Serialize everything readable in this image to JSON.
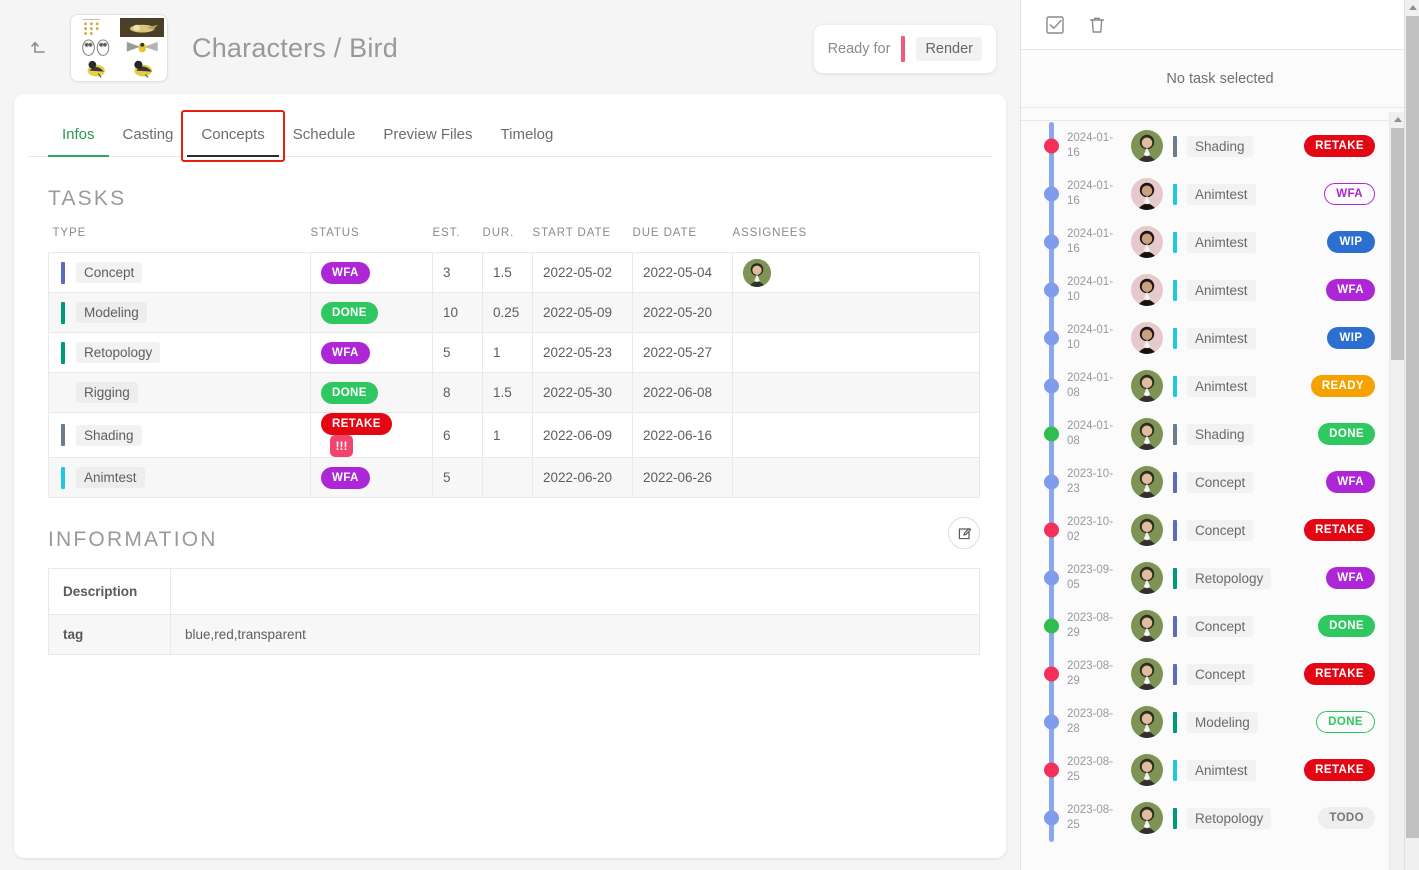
{
  "header": {
    "back_icon": "return-arrow-icon",
    "thumbnail_alt": "bird-concept-thumbnail",
    "title": "Characters / Bird",
    "ready_for_label": "Ready for",
    "ready_for_value": "Render"
  },
  "tabs": [
    {
      "label": "Infos",
      "state": "active-green"
    },
    {
      "label": "Casting",
      "state": ""
    },
    {
      "label": "Concepts",
      "state": "active-dark"
    },
    {
      "label": "Schedule",
      "state": ""
    },
    {
      "label": "Preview Files",
      "state": ""
    },
    {
      "label": "Timelog",
      "state": ""
    }
  ],
  "tasks_section": {
    "title": "TASKS",
    "columns": [
      "TYPE",
      "STATUS",
      "EST.",
      "DUR.",
      "START DATE",
      "DUE DATE",
      "ASSIGNEES"
    ],
    "rows": [
      {
        "type": "Concept",
        "type_color": "#5b6bc0",
        "status": "WFA",
        "status_color": "#ad27d6",
        "priority": null,
        "est": "3",
        "dur": "1.5",
        "start": "2022-05-02",
        "due": "2022-05-04",
        "assignee": "a1"
      },
      {
        "type": "Modeling",
        "type_color": "#00997a",
        "status": "DONE",
        "status_color": "#2fc75f",
        "priority": null,
        "est": "10",
        "dur": "0.25",
        "start": "2022-05-09",
        "due": "2022-05-20",
        "assignee": null
      },
      {
        "type": "Retopology",
        "type_color": "#00997a",
        "status": "WFA",
        "status_color": "#ad27d6",
        "priority": null,
        "est": "5",
        "dur": "1",
        "start": "2022-05-23",
        "due": "2022-05-27",
        "assignee": null
      },
      {
        "type": "Rigging",
        "type_color": "#8cc košice",
        "status": "DONE",
        "status_color": "#2fc75f",
        "priority": null,
        "est": "8",
        "dur": "1.5",
        "start": "2022-05-30",
        "due": "2022-06-08",
        "assignee": null
      },
      {
        "type": "Shading",
        "type_color": "#6b7c8c",
        "status": "RETAKE",
        "status_color": "#e30613",
        "priority": "!!!",
        "est": "6",
        "dur": "1",
        "start": "2022-06-09",
        "due": "2022-06-16",
        "assignee": null
      },
      {
        "type": "Animtest",
        "type_color": "#1ec8e0",
        "status": "WFA",
        "status_color": "#ad27d6",
        "priority": null,
        "est": "5",
        "dur": "",
        "start": "2022-06-20",
        "due": "2022-06-26",
        "assignee": null
      }
    ]
  },
  "information_section": {
    "title": "INFORMATION",
    "edit_icon": "edit-pencil-icon",
    "rows": [
      {
        "key": "Description",
        "value": ""
      },
      {
        "key": "tag",
        "value": "blue,red,transparent"
      }
    ]
  },
  "right_panel": {
    "toolbar": [
      {
        "icon": "checkbox-check-icon"
      },
      {
        "icon": "trash-icon"
      }
    ],
    "empty_message": "No task selected",
    "feed": [
      {
        "date": "2024-01-16",
        "avatar": "a1",
        "type": "Shading",
        "type_color": "#6b7c8c",
        "status": "RETAKE",
        "status_color": "#e30613",
        "outline": false,
        "dot": "red"
      },
      {
        "date": "2024-01-16",
        "avatar": "a2",
        "type": "Animtest",
        "type_color": "#1ec8e0",
        "status": "WFA",
        "status_color": "#ad27d6",
        "outline": true,
        "dot": "blue"
      },
      {
        "date": "2024-01-16",
        "avatar": "a2",
        "type": "Animtest",
        "type_color": "#1ec8e0",
        "status": "WIP",
        "status_color": "#2c6fd1",
        "outline": false,
        "dot": "blue"
      },
      {
        "date": "2024-01-10",
        "avatar": "a2",
        "type": "Animtest",
        "type_color": "#1ec8e0",
        "status": "WFA",
        "status_color": "#ad27d6",
        "outline": false,
        "dot": "blue"
      },
      {
        "date": "2024-01-10",
        "avatar": "a2",
        "type": "Animtest",
        "type_color": "#1ec8e0",
        "status": "WIP",
        "status_color": "#2c6fd1",
        "outline": false,
        "dot": "blue"
      },
      {
        "date": "2024-01-08",
        "avatar": "a1",
        "type": "Animtest",
        "type_color": "#1ec8e0",
        "status": "READY",
        "status_color": "#f5a200",
        "outline": false,
        "dot": "blue"
      },
      {
        "date": "2024-01-08",
        "avatar": "a1",
        "type": "Shading",
        "type_color": "#6b7c8c",
        "status": "DONE",
        "status_color": "#2fc75f",
        "outline": false,
        "dot": "green"
      },
      {
        "date": "2023-10-23",
        "avatar": "a1",
        "type": "Concept",
        "type_color": "#5b6bc0",
        "status": "WFA",
        "status_color": "#ad27d6",
        "outline": false,
        "dot": "blue"
      },
      {
        "date": "2023-10-02",
        "avatar": "a1",
        "type": "Concept",
        "type_color": "#5b6bc0",
        "status": "RETAKE",
        "status_color": "#e30613",
        "outline": false,
        "dot": "red"
      },
      {
        "date": "2023-09-05",
        "avatar": "a1",
        "type": "Retopology",
        "type_color": "#00997a",
        "status": "WFA",
        "status_color": "#ad27d6",
        "outline": false,
        "dot": "blue"
      },
      {
        "date": "2023-08-29",
        "avatar": "a1",
        "type": "Concept",
        "type_color": "#5b6bc0",
        "status": "DONE",
        "status_color": "#2fc75f",
        "outline": false,
        "dot": "green"
      },
      {
        "date": "2023-08-29",
        "avatar": "a1",
        "type": "Concept",
        "type_color": "#5b6bc0",
        "status": "RETAKE",
        "status_color": "#e30613",
        "outline": false,
        "dot": "red"
      },
      {
        "date": "2023-08-28",
        "avatar": "a1",
        "type": "Modeling",
        "type_color": "#00997a",
        "status": "DONE",
        "status_color": "#2fc75f",
        "outline": true,
        "dot": "blue"
      },
      {
        "date": "2023-08-25",
        "avatar": "a1",
        "type": "Animtest",
        "type_color": "#1ec8e0",
        "status": "RETAKE",
        "status_color": "#e30613",
        "outline": false,
        "dot": "red"
      },
      {
        "date": "2023-08-25",
        "avatar": "a1",
        "type": "Retopology",
        "type_color": "#00997a",
        "status": "TODO",
        "status_color": "#eeeeee",
        "outline": false,
        "dot": "blue"
      }
    ]
  }
}
